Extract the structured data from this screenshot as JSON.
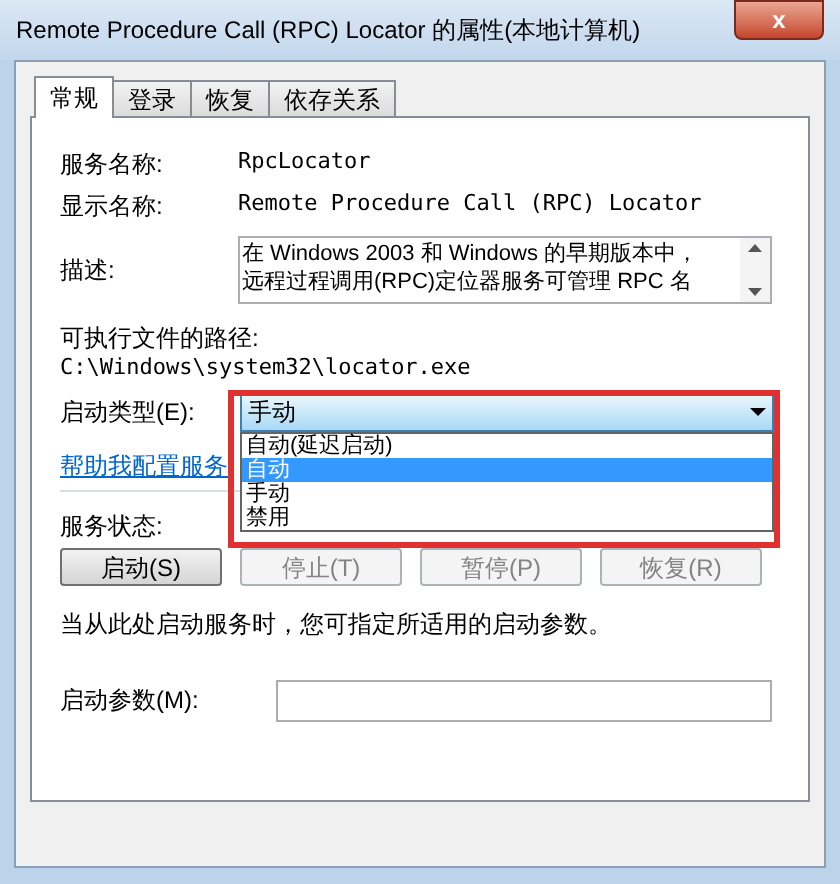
{
  "window": {
    "title": "Remote Procedure Call (RPC) Locator 的属性(本地计算机)",
    "close": "x"
  },
  "tabs": [
    {
      "label": "常规",
      "selected": true
    },
    {
      "label": "登录",
      "selected": false
    },
    {
      "label": "恢复",
      "selected": false
    },
    {
      "label": "依存关系",
      "selected": false
    }
  ],
  "service_name": {
    "label": "服务名称:",
    "value": "RpcLocator"
  },
  "display_name": {
    "label": "显示名称:",
    "value": "Remote Procedure Call (RPC) Locator"
  },
  "description": {
    "label": "描述:",
    "lines": [
      "在 Windows 2003 和 Windows 的早期版本中，",
      "远程过程调用(RPC)定位器服务可管理 RPC 名"
    ]
  },
  "executable_path": {
    "label": "可执行文件的路径:",
    "value": "C:\\Windows\\system32\\locator.exe"
  },
  "startup_type": {
    "label": "启动类型(E):",
    "value": "手动",
    "expanded": true,
    "options": [
      {
        "label": "自动(延迟启动)",
        "highlighted": false
      },
      {
        "label": "自动",
        "highlighted": true
      },
      {
        "label": "手动",
        "highlighted": false
      },
      {
        "label": "禁用",
        "highlighted": false
      }
    ]
  },
  "help_link": "帮助我配置服务",
  "service_status": {
    "label": "服务状态:"
  },
  "buttons": [
    {
      "label": "启动(S)",
      "disabled": false
    },
    {
      "label": "停止(T)",
      "disabled": true
    },
    {
      "label": "暂停(P)",
      "disabled": true
    },
    {
      "label": "恢复(R)",
      "disabled": true
    }
  ],
  "hint": "当从此处启动服务时，您可指定所适用的启动参数。",
  "start_parameters": {
    "label": "启动参数(M):"
  },
  "highlight_frame": true
}
